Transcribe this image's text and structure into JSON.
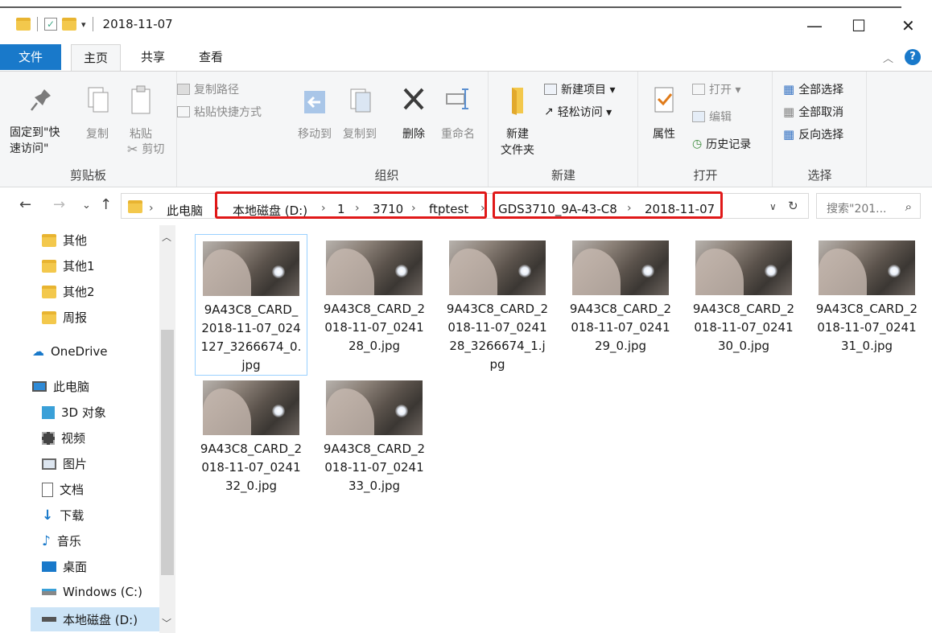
{
  "window": {
    "title": "2018-11-07",
    "qat_dropdown": "▾",
    "minimize": "—",
    "maximize": "☐",
    "close": "✕"
  },
  "tabs": [
    {
      "label": "文件"
    },
    {
      "label": "主页"
    },
    {
      "label": "共享"
    },
    {
      "label": "查看"
    }
  ],
  "ribbon": {
    "clipboard": {
      "pin": "固定到\"快\n速访问\"",
      "copy": "复制",
      "paste": "粘贴",
      "copy_path": "复制路径",
      "paste_shortcut": "粘贴快捷方式",
      "cut": "剪切",
      "label": "剪贴板"
    },
    "organize": {
      "move_to": "移动到",
      "copy_to": "复制到",
      "delete": "删除",
      "rename": "重命名",
      "label": "组织"
    },
    "new": {
      "new_folder": "新建\n文件夹",
      "new_item": "新建项目 ▾",
      "easy_access": "轻松访问 ▾",
      "label": "新建"
    },
    "open": {
      "properties": "属性",
      "open": "打开 ▾",
      "edit": "编辑",
      "history": "历史记录",
      "label": "打开"
    },
    "select": {
      "select_all": "全部选择",
      "select_none": "全部取消",
      "invert": "反向选择",
      "label": "选择"
    }
  },
  "address": {
    "crumbs": [
      "此电脑",
      "本地磁盘 (D:)",
      "1",
      "3710",
      "ftptest",
      "GDS3710_9A-43-C8",
      "2018-11-07"
    ],
    "search_placeholder": "搜索\"201...",
    "highlight_color": "#e01818"
  },
  "nav_pane": {
    "items": [
      {
        "label": "其他",
        "icon": "folder-icon"
      },
      {
        "label": "其他1",
        "icon": "folder-icon"
      },
      {
        "label": "其他2",
        "icon": "folder-icon"
      },
      {
        "label": "周报",
        "icon": "folder-icon"
      },
      {
        "label": "OneDrive",
        "icon": "cloud-icon"
      },
      {
        "label": "此电脑",
        "icon": "computer-icon"
      },
      {
        "label": "3D 对象",
        "icon": "cube-icon"
      },
      {
        "label": "视频",
        "icon": "video-icon"
      },
      {
        "label": "图片",
        "icon": "picture-icon"
      },
      {
        "label": "文档",
        "icon": "document-icon"
      },
      {
        "label": "下载",
        "icon": "download-icon"
      },
      {
        "label": "音乐",
        "icon": "music-icon"
      },
      {
        "label": "桌面",
        "icon": "desktop-icon"
      },
      {
        "label": "Windows (C:)",
        "icon": "drive-icon"
      },
      {
        "label": "本地磁盘 (D:)",
        "icon": "drive-icon"
      }
    ]
  },
  "files": [
    {
      "name": "9A43C8_CARD_2018-11-07_024127_3266674_0.jpg"
    },
    {
      "name": "9A43C8_CARD_2018-11-07_024128_0.jpg"
    },
    {
      "name": "9A43C8_CARD_2018-11-07_024128_3266674_1.jpg"
    },
    {
      "name": "9A43C8_CARD_2018-11-07_024129_0.jpg"
    },
    {
      "name": "9A43C8_CARD_2018-11-07_024130_0.jpg"
    },
    {
      "name": "9A43C8_CARD_2018-11-07_024131_0.jpg"
    },
    {
      "name": "9A43C8_CARD_2018-11-07_024132_0.jpg"
    },
    {
      "name": "9A43C8_CARD_2018-11-07_024133_0.jpg"
    }
  ]
}
